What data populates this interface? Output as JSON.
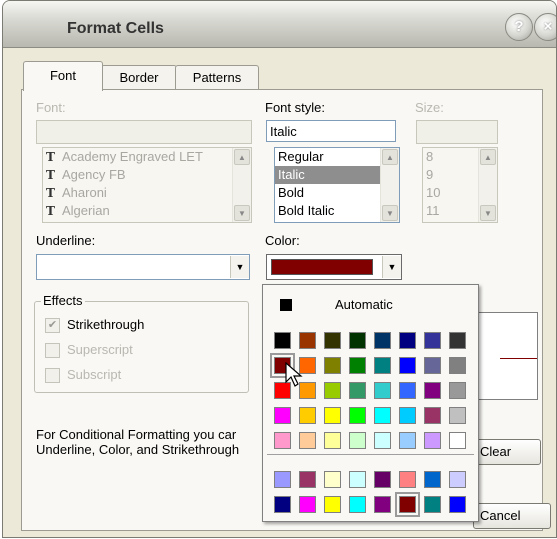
{
  "window": {
    "title": "Format Cells"
  },
  "tabs": [
    {
      "label": "Font",
      "active": true
    },
    {
      "label": "Border",
      "active": false
    },
    {
      "label": "Patterns",
      "active": false
    }
  ],
  "font": {
    "label": "Font:",
    "value": "",
    "items": [
      "Academy Engraved LET",
      "Agency FB",
      "Aharoni",
      "Algerian"
    ]
  },
  "font_style": {
    "label": "Font style:",
    "value": "Italic",
    "items": [
      "Regular",
      "Italic",
      "Bold",
      "Bold Italic"
    ],
    "selected": "Italic"
  },
  "size": {
    "label": "Size:",
    "value": "",
    "items": [
      "8",
      "9",
      "10",
      "11"
    ]
  },
  "underline": {
    "label": "Underline:",
    "value": ""
  },
  "color": {
    "label": "Color:",
    "value": "#800000"
  },
  "effects": {
    "legend": "Effects",
    "strikethrough": {
      "label": "Strikethrough",
      "checked": true
    },
    "superscript": {
      "label": "Superscript",
      "checked": false
    },
    "subscript": {
      "label": "Subscript",
      "checked": false
    }
  },
  "note": {
    "line1": "For Conditional Formatting you car",
    "line2": "Underline, Color, and Strikethrough"
  },
  "buttons": {
    "clear": "Clear",
    "cancel": "Cancel"
  },
  "color_popup": {
    "automatic_label": "Automatic",
    "automatic_color": "#000000",
    "selected_color": "#800000",
    "palette": [
      [
        "#000000",
        "#993300",
        "#333300",
        "#003300",
        "#003366",
        "#000080",
        "#333399",
        "#333333"
      ],
      [
        "#800000",
        "#FF6600",
        "#808000",
        "#008000",
        "#008080",
        "#0000FF",
        "#666699",
        "#808080"
      ],
      [
        "#FF0000",
        "#FF9900",
        "#99CC00",
        "#339966",
        "#33CCCC",
        "#3366FF",
        "#800080",
        "#999999"
      ],
      [
        "#FF00FF",
        "#FFCC00",
        "#FFFF00",
        "#00FF00",
        "#00FFFF",
        "#00CCFF",
        "#993366",
        "#C0C0C0"
      ],
      [
        "#FF99CC",
        "#FFCC99",
        "#FFFF99",
        "#CCFFCC",
        "#CCFFFF",
        "#99CCFF",
        "#CC99FF",
        "#FFFFFF"
      ]
    ],
    "chart_palette": [
      [
        "#9999FF",
        "#993366",
        "#FFFFCC",
        "#CCFFFF",
        "#660066",
        "#FF8080",
        "#0066CC",
        "#CCCCFF"
      ],
      [
        "#000080",
        "#FF00FF",
        "#FFFF00",
        "#00FFFF",
        "#800080",
        "#800000",
        "#008080",
        "#0000FF"
      ]
    ]
  }
}
